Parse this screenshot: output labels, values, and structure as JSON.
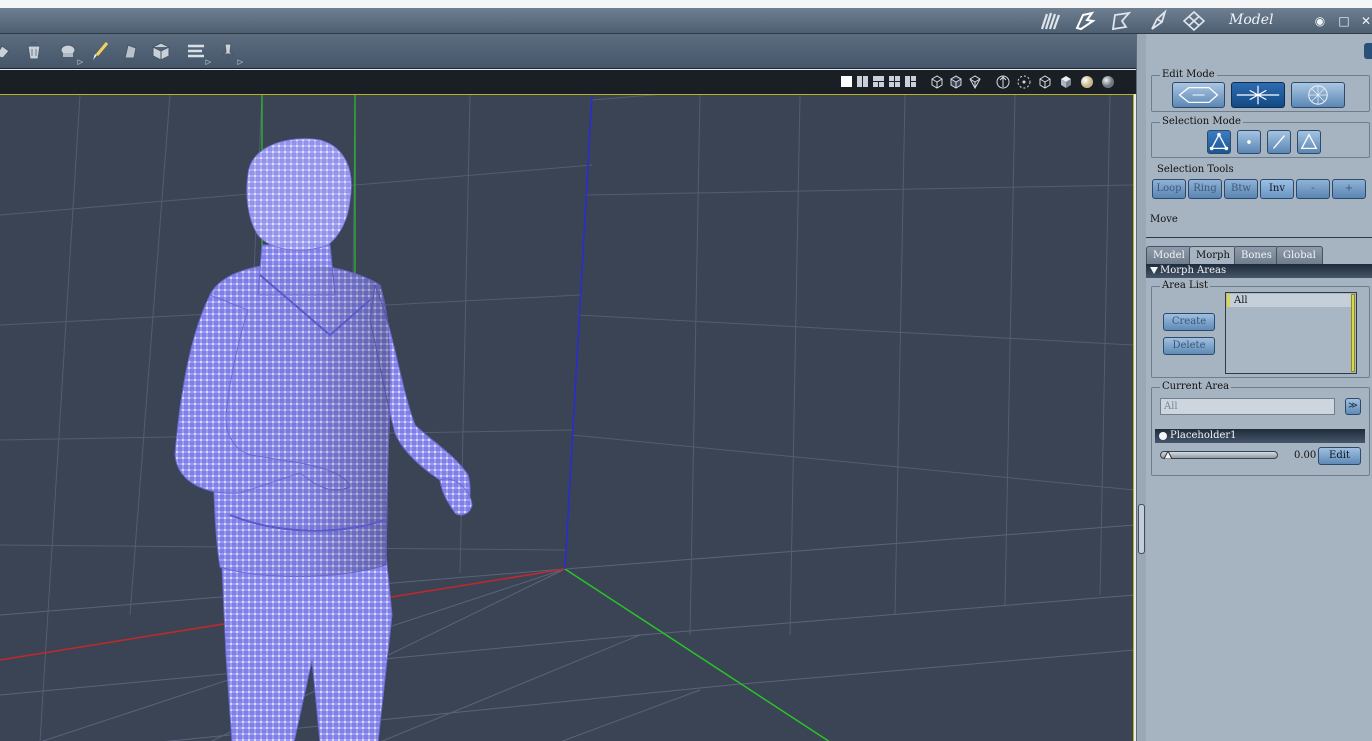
{
  "room_bar": {
    "title": "Model",
    "room_icons": [
      "hair-room-icon",
      "cloth-room-icon",
      "rig-room-icon",
      "model-room-icon",
      "texture-room-icon"
    ],
    "window_controls": {
      "visibility": "◉",
      "maximize": "□",
      "close": "✕"
    }
  },
  "toolbar": {
    "tools": [
      "grab-tool-icon",
      "trash-tool-icon",
      "smooth-tool-icon",
      "brush-tool-icon",
      "magnet-tool-icon",
      "cube-tool-icon",
      "tape-tool-icon",
      "pin-tool-icon"
    ]
  },
  "viewport_header": {
    "layout_icons": [
      "single-view-icon",
      "two-view-icon",
      "three-view-icon",
      "four-view-icon",
      "quad-view-icon"
    ],
    "display_icons": [
      "wireframe-mode-icon",
      "hidden-line-mode-icon",
      "lit-wire-mode-icon",
      "axis-icon",
      "bounding-box-icon",
      "cube-wire-icon",
      "cube-shaded-icon",
      "smooth-shaded-icon",
      "texture-shaded-icon"
    ]
  },
  "panel": {
    "edit_mode": {
      "title": "Edit Mode",
      "buttons": [
        "mesh-edit-icon",
        "morph-edit-icon",
        "sculpt-edit-icon"
      ],
      "active_index": 1
    },
    "selection_mode": {
      "title": "Selection Mode",
      "buttons": [
        "vertex-select-icon",
        "point-select-icon",
        "edge-select-icon",
        "face-select-icon"
      ],
      "active_index": 0
    },
    "selection_tools": {
      "title": "Selection Tools",
      "buttons": [
        "Loop",
        "Ring",
        "Btw",
        "Inv",
        "-",
        "+"
      ],
      "active_label": "Inv"
    },
    "status_label": "Move",
    "tabs": [
      "Model",
      "Morph",
      "Bones",
      "Global"
    ],
    "active_tab": "Morph",
    "morph_areas": {
      "header": "Morph Areas",
      "area_list": {
        "title": "Area List",
        "create_label": "Create",
        "delete_label": "Delete",
        "items": [
          "All"
        ]
      },
      "current_area": {
        "title": "Current Area",
        "value": "All",
        "dropdown_glyph": "≫"
      },
      "morph": {
        "name": "Placeholder1",
        "value": "0.00",
        "slider_fraction": 0.0,
        "edit_label": "Edit"
      }
    }
  },
  "colors": {
    "viewport_bg": "#3b4454",
    "mesh_vertex": "#8c8cf4",
    "x_axis": "#c42828",
    "y_axis": "#28c428",
    "z_axis": "#2a2ad8",
    "panel_bg": "#a6b3c1"
  }
}
